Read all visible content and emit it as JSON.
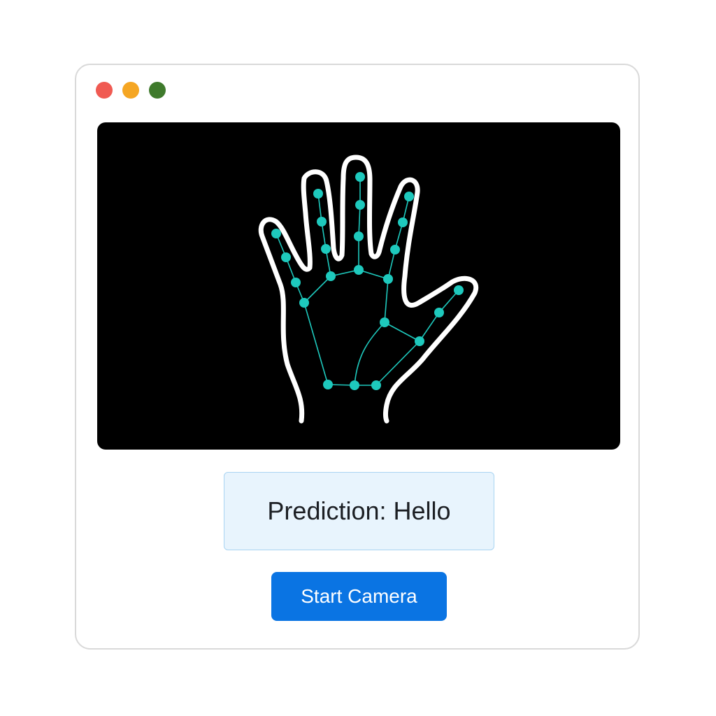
{
  "window": {
    "controls": [
      {
        "name": "close",
        "color": "#f05a52"
      },
      {
        "name": "minimize",
        "color": "#f5a623"
      },
      {
        "name": "maximize",
        "color": "#3f7a2c"
      }
    ]
  },
  "camera": {
    "icon": "hand-landmarks-icon",
    "landmark_color": "#1ec9bd",
    "outline_color": "#ffffff"
  },
  "prediction": {
    "label": "Prediction:",
    "value": "Hello"
  },
  "actions": {
    "start_camera_label": "Start Camera",
    "button_color": "#0a74e3"
  }
}
